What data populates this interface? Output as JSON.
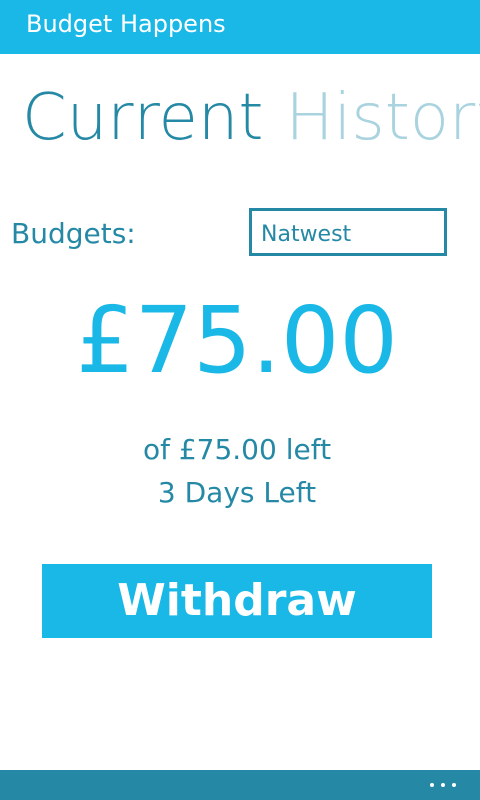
{
  "app": {
    "title": "Budget Happens"
  },
  "pivot": {
    "tabs": [
      {
        "label": "Current"
      },
      {
        "label": "History"
      }
    ]
  },
  "budget": {
    "label": "Budgets:",
    "selected": "Natwest",
    "amount": "£75.00",
    "of_left": "of £75.00 left",
    "days_left": "3 Days Left"
  },
  "actions": {
    "withdraw_label": "Withdraw"
  },
  "appbar": {
    "more_icon": "ellipsis-icon"
  },
  "colors": {
    "accent": "#1ab8e6",
    "text": "#2589a6",
    "inactive_tab": "#a9d3df",
    "appbar": "#2589a6"
  }
}
